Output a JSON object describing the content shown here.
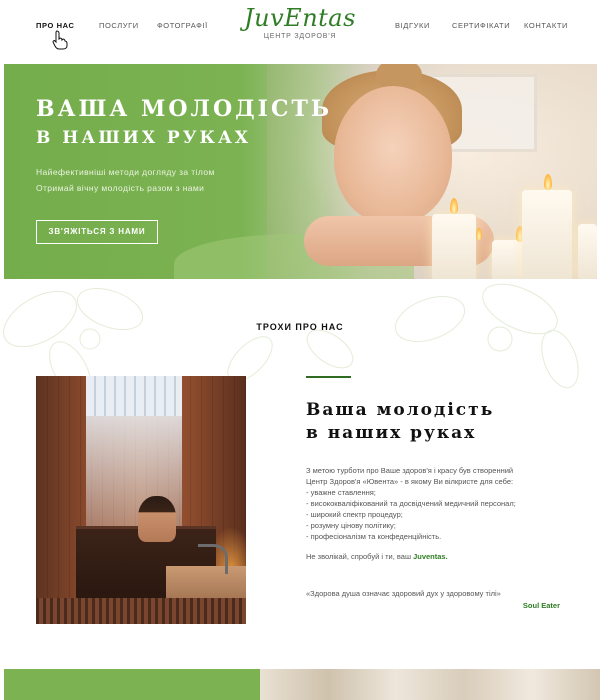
{
  "nav": {
    "items_left": [
      "ПРО НАС",
      "ПОСЛУГИ",
      "ФОТОГРАФІЇ"
    ],
    "items_right": [
      "ВІДГУКИ",
      "СЕРТИФІКАТИ",
      "КОНТАКТИ"
    ],
    "active": "ПРО НАС"
  },
  "logo": {
    "title": "JuvEntas",
    "subtitle": "ЦЕНТР ЗДОРОВ'Я"
  },
  "hero": {
    "title_line1": "ВАША МОЛОДІСТЬ",
    "title_line2": "В НАШИХ РУКАХ",
    "text_line1": "Найефективніші методи догляду за тілом",
    "text_line2": "Отримай вічну молодість разом з нами",
    "button_label": "ЗВ'ЯЖІТЬСЯ З НАМИ"
  },
  "about": {
    "heading": "ТРОХИ ПРО НАС",
    "title_line1": "Ваша молодість",
    "title_line2": "в наших руках",
    "body": [
      "З метою турботи про Ваше здоров'я і красу був створенний",
      "Центр Здоров'я «Ювента» - в якому Ви вілкристе для себе:",
      "- уважне ставлення;",
      "- висококваліфікований та досвідчений медичний персонал;",
      "- широкий спектр процедур;",
      "- розумну цінову політику;",
      "- професіоналізм та конфеденційність."
    ],
    "cta_prefix": "Не зволікай, спробуй і ти, ваш",
    "cta_brand": "Juventas.",
    "quote": "«Здорова душа означає здоровий дух у здоровому тілі»",
    "quote_author": "Soul Eater"
  },
  "colors": {
    "brand_green": "#7cb252",
    "dark_green": "#2f7d24"
  }
}
